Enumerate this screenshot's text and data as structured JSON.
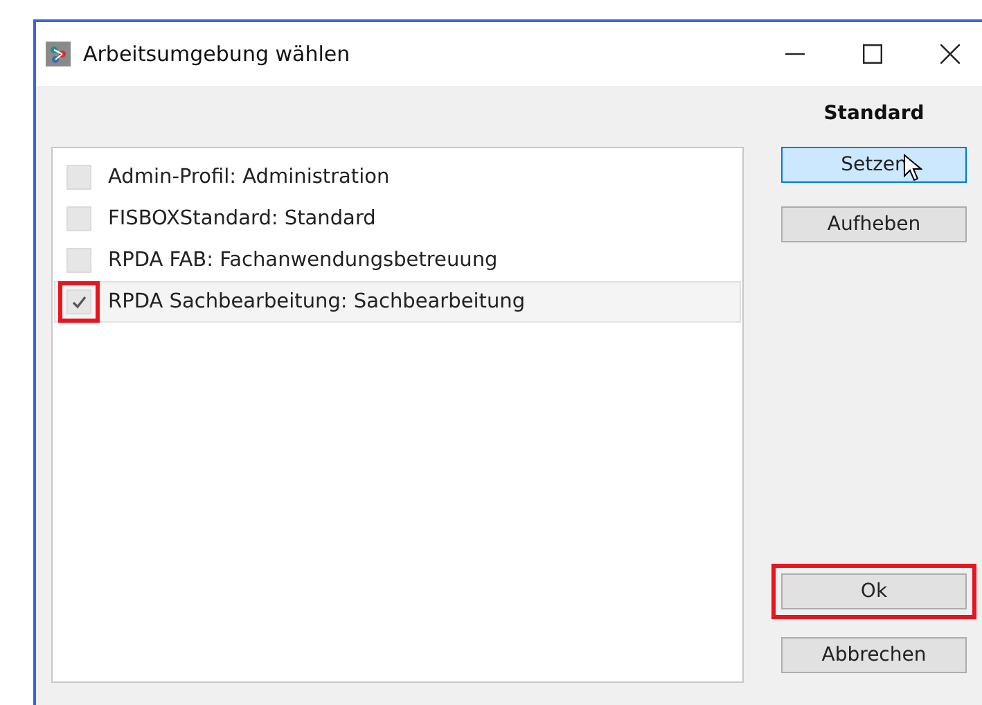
{
  "window": {
    "title": "Arbeitsumgebung wählen"
  },
  "profiles": [
    {
      "label": "Admin-Profil: Administration",
      "checked": false,
      "selected": false,
      "highlighted": false
    },
    {
      "label": "FISBOXStandard: Standard",
      "checked": false,
      "selected": false,
      "highlighted": false
    },
    {
      "label": "RPDA FAB: Fachanwendungsbetreuung",
      "checked": false,
      "selected": false,
      "highlighted": false
    },
    {
      "label": "RPDA Sachbearbeitung: Sachbearbeitung",
      "checked": true,
      "selected": true,
      "highlighted": true
    }
  ],
  "default_heading": "Standard",
  "default_buttons": [
    {
      "label": "Setzen",
      "hovered": true
    },
    {
      "label": "Aufheben",
      "hovered": false
    }
  ],
  "buttons": [
    {
      "label": "Ok",
      "highlighted": true
    },
    {
      "label": "Abbrechen",
      "highlighted": false
    }
  ]
}
